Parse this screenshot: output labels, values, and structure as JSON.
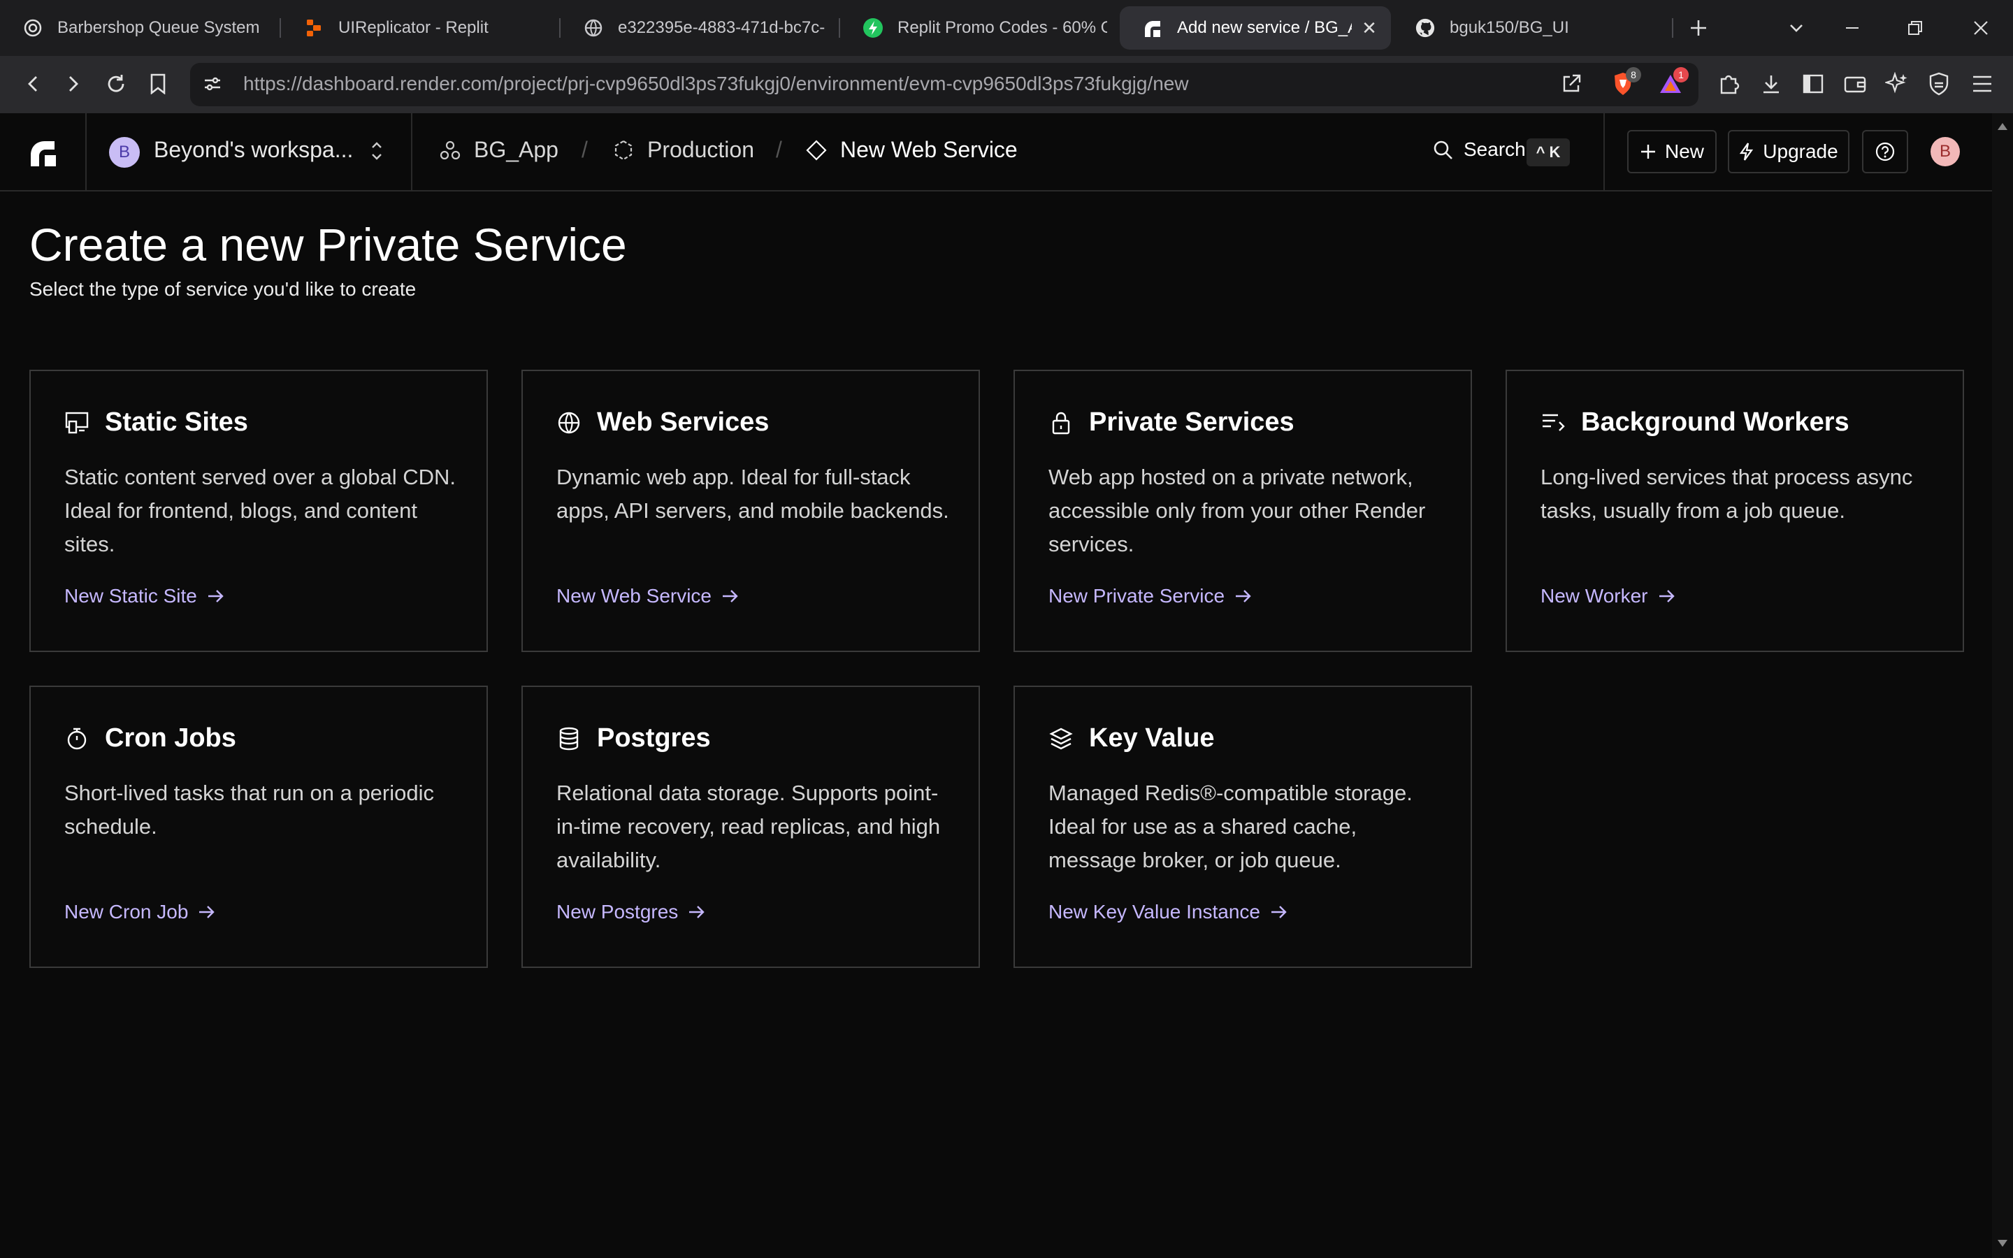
{
  "browser": {
    "tabs": [
      {
        "title": "Barbershop Queue System",
        "icon": "openai-icon"
      },
      {
        "title": "UIReplicator - Replit",
        "icon": "replit-icon"
      },
      {
        "title": "e322395e-4883-471d-bc7c-",
        "icon": "globe-icon"
      },
      {
        "title": "Replit Promo Codes - 60% O",
        "icon": "bolt-icon"
      },
      {
        "title": "Add new service / BG_A",
        "icon": "render-icon",
        "active": true
      },
      {
        "title": "bguk150/BG_UI",
        "icon": "github-icon"
      }
    ],
    "url_host": "https://dashboard.render.com",
    "url_path": "/project/prj-cvp9650dl3ps73fukgj0/environment/evm-cvp9650dl3ps73fukgjg/new",
    "brave_badge": "8",
    "rewards_badge": "1"
  },
  "header": {
    "workspace_avatar": "B",
    "workspace_name": "Beyond's workspa...",
    "breadcrumbs": [
      "BG_App",
      "Production",
      "New Web Service"
    ],
    "search_label": "Search",
    "search_shortcut": "^ K",
    "new_label": "New",
    "upgrade_label": "Upgrade",
    "user_avatar": "B"
  },
  "main": {
    "title": "Create a new Private Service",
    "subtitle": "Select the type of service you'd like to create",
    "cards": [
      {
        "name": "Static Sites",
        "icon": "static-site-icon",
        "desc": "Static content served over a global CDN. Ideal for frontend, blogs, and content sites.",
        "link": "New Static Site"
      },
      {
        "name": "Web Services",
        "icon": "globe-icon",
        "desc": "Dynamic web app. Ideal for full-stack apps, API servers, and mobile backends.",
        "link": "New Web Service"
      },
      {
        "name": "Private Services",
        "icon": "lock-icon",
        "desc": "Web app hosted on a private network, accessible only from your other Render services.",
        "link": "New Private Service"
      },
      {
        "name": "Background Workers",
        "icon": "list-icon",
        "desc": "Long-lived services that process async tasks, usually from a job queue.",
        "link": "New Worker"
      },
      {
        "name": "Cron Jobs",
        "icon": "stopwatch-icon",
        "desc": "Short-lived tasks that run on a periodic schedule.",
        "link": "New Cron Job"
      },
      {
        "name": "Postgres",
        "icon": "database-icon",
        "desc": "Relational data storage. Supports point-in-time recovery, read replicas, and high availability.",
        "link": "New Postgres"
      },
      {
        "name": "Key Value",
        "icon": "layers-icon",
        "desc": "Managed Redis®-compatible storage. Ideal for use as a shared cache, message broker, or job queue.",
        "link": "New Key Value Instance"
      }
    ]
  },
  "colors": {
    "background": "#0a0a0a",
    "card_border": "#3a3a3a",
    "link": "#c6b8ff",
    "avatar_workspace": "#c9bdf5",
    "avatar_user": "#f2b8b8"
  }
}
